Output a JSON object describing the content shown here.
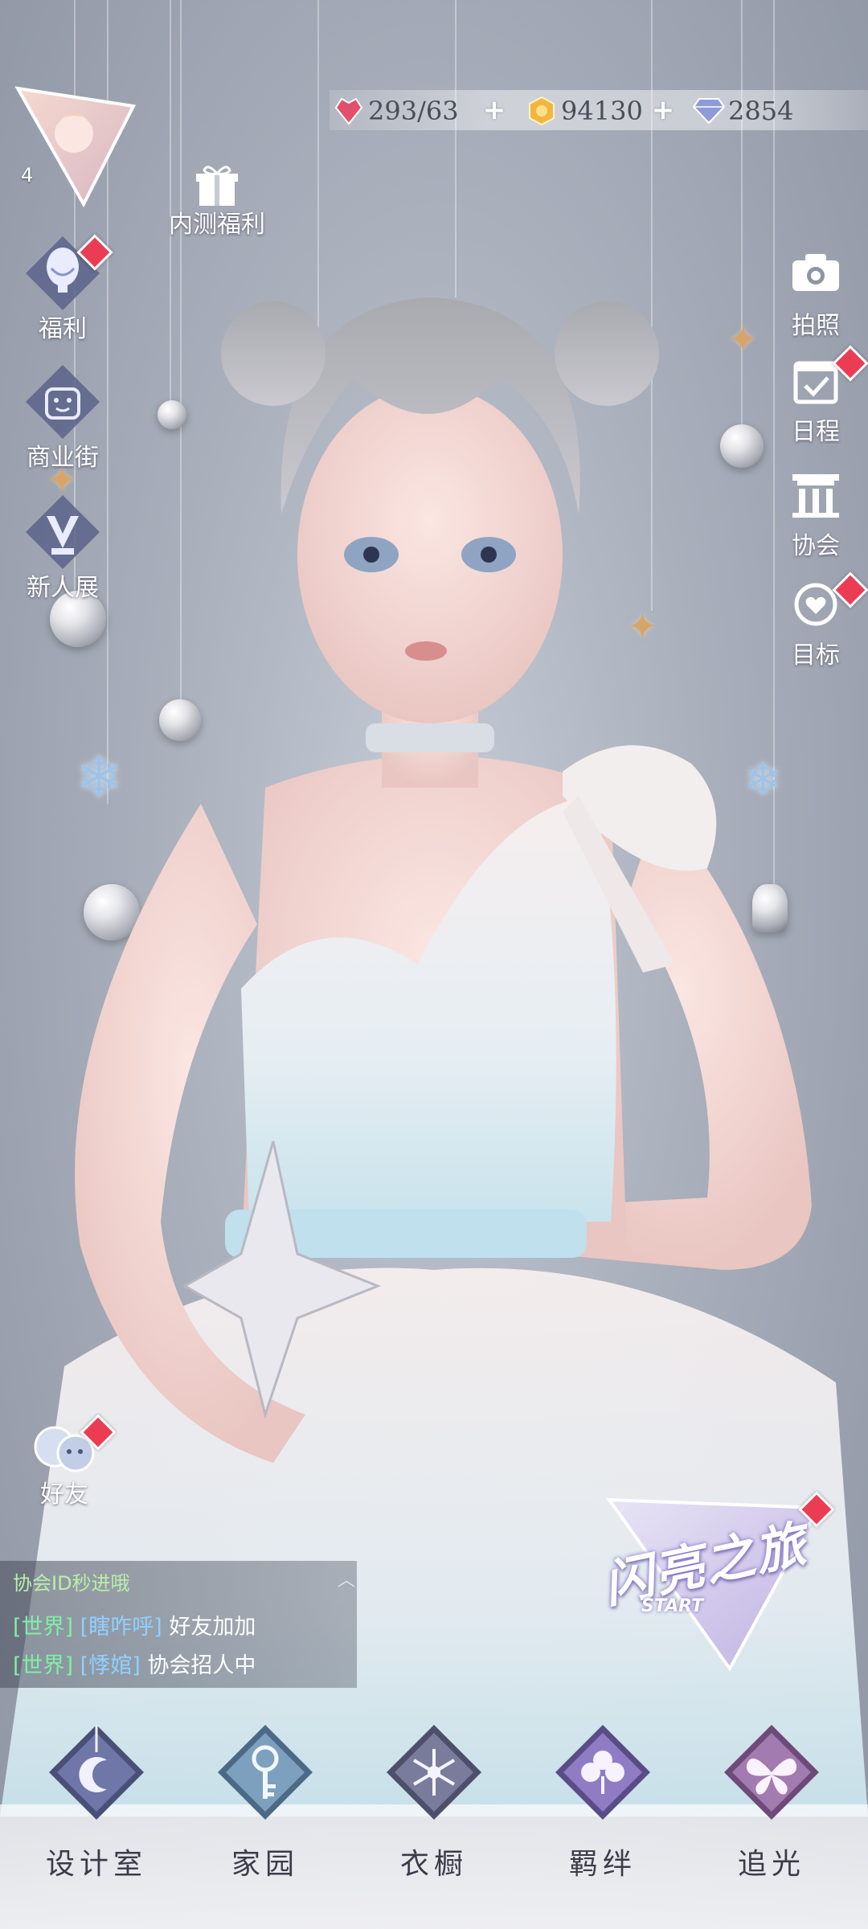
{
  "resources": [
    {
      "icon": "heart-gem-icon",
      "value": "293/63",
      "color": "#e2506c"
    },
    {
      "icon": "gold-coin-icon",
      "value": "94130",
      "color": "#f2b640"
    },
    {
      "icon": "diamond-icon",
      "value": "2854",
      "color": "#8f9bd8"
    }
  ],
  "player": {
    "level": "4"
  },
  "beta_gift": {
    "label": "内测福利",
    "icon": "gift-box-icon"
  },
  "left_menu": [
    {
      "label": "福利",
      "icon": "hot-air-balloon-icon",
      "badge": true
    },
    {
      "label": "商业街",
      "icon": "shopping-bag-icon",
      "badge": false
    },
    {
      "label": "新人展",
      "icon": "trophy-v-icon",
      "badge": false
    }
  ],
  "right_menu": [
    {
      "label": "拍照",
      "icon": "camera-icon",
      "badge": false
    },
    {
      "label": "日程",
      "icon": "calendar-check-icon",
      "badge": true
    },
    {
      "label": "协会",
      "icon": "guild-hall-icon",
      "badge": false
    },
    {
      "label": "目标",
      "icon": "heart-medal-icon",
      "badge": true
    }
  ],
  "friends": {
    "label": "好友",
    "icon": "friends-icon",
    "badge": true
  },
  "chat": {
    "top_line": "协会ID秒进哦",
    "messages": [
      {
        "channel": "[世界]",
        "name": "[瞎咋呼]",
        "text": "好友加加"
      },
      {
        "channel": "[世界]",
        "name": "[悸婠]",
        "text": "协会招人中"
      }
    ]
  },
  "event": {
    "title": "闪亮之旅",
    "subtitle": "START",
    "badge": true
  },
  "bottom_nav": [
    {
      "label": "设计室",
      "icon": "moon-pendant-icon"
    },
    {
      "label": "家园",
      "icon": "key-icon"
    },
    {
      "label": "衣橱",
      "icon": "crystal-snowflake-icon"
    },
    {
      "label": "羁绊",
      "icon": "clover-icon"
    },
    {
      "label": "追光",
      "icon": "butterfly-icon"
    }
  ],
  "colors": {
    "accent": "#ea3d54",
    "background": "#a9afbb",
    "chat_channel": "#7ff0a6",
    "chat_name": "#8fd0ff"
  }
}
